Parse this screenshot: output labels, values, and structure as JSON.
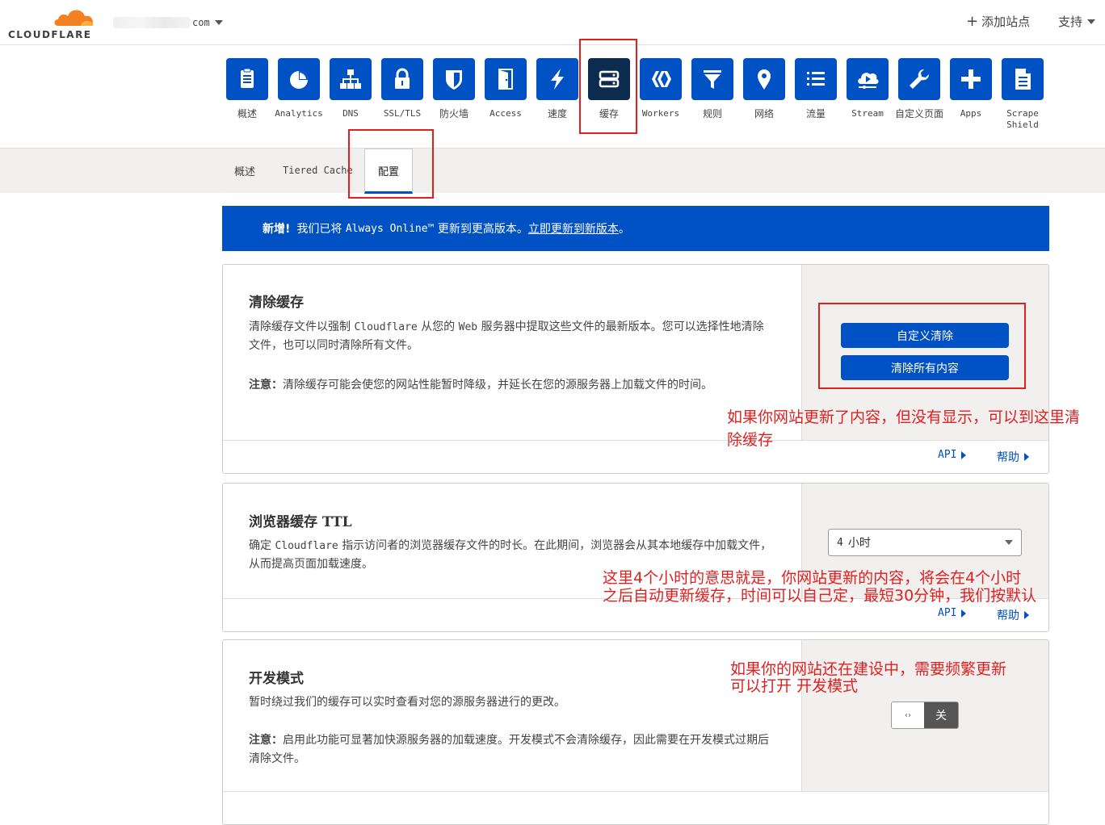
{
  "header": {
    "logo_text": "CLOUDFLARE",
    "domain_suffix": "com",
    "add_site_label": "添加站点",
    "support_label": "支持"
  },
  "apps": [
    {
      "label": "概述",
      "icon": "clipboard-icon"
    },
    {
      "label": "Analytics",
      "icon": "pie-chart-icon"
    },
    {
      "label": "DNS",
      "icon": "network-icon"
    },
    {
      "label": "SSL/TLS",
      "icon": "lock-icon"
    },
    {
      "label": "防火墙",
      "icon": "shield-icon"
    },
    {
      "label": "Access",
      "icon": "door-icon"
    },
    {
      "label": "速度",
      "icon": "lightning-icon"
    },
    {
      "label": "缓存",
      "icon": "server-icon"
    },
    {
      "label": "Workers",
      "icon": "workers-icon"
    },
    {
      "label": "规则",
      "icon": "filter-icon"
    },
    {
      "label": "网络",
      "icon": "location-pin-icon"
    },
    {
      "label": "流量",
      "icon": "list-icon"
    },
    {
      "label": "Stream",
      "icon": "cloud-play-icon"
    },
    {
      "label": "自定义页面",
      "icon": "wrench-icon"
    },
    {
      "label": "Apps",
      "icon": "plus-icon"
    },
    {
      "label": "Scrape\nShield",
      "icon": "document-icon"
    }
  ],
  "subnav": {
    "tab_overview": "概述",
    "tab_tiered": "Tiered Cache",
    "tab_config": "配置"
  },
  "banner": {
    "bold": "新增!",
    "text1": "我们已将",
    "product": "Always Online™",
    "text2": "更新到更高版本。",
    "link": "立即更新到新版本",
    "end": "。"
  },
  "purge": {
    "title": "清除缓存",
    "desc_a": "清除缓存文件以强制",
    "desc_cf": "Cloudflare",
    "desc_b": "从您的",
    "desc_web": "Web",
    "desc_c": "服务器中提取这些文件的最新版本。您可以选择性地清除文件，也可以同时清除所有文件。",
    "note_label": "注意：",
    "note_text": "清除缓存可能会使您的网站性能暂时降级，并延长在您的源服务器上加载文件的时间。",
    "custom_button": "自定义清除",
    "all_button": "清除所有内容",
    "api_link": "API",
    "help_link": "帮助"
  },
  "browser_ttl": {
    "title_a": "浏览器缓存",
    "title_b": "TTL",
    "desc_a": "确定",
    "desc_cf": "Cloudflare",
    "desc_b": "指示访问者的浏览器缓存文件的时长。在此期间，浏览器会从其本地缓存中加载文件，从而提高页面加载速度。",
    "select_num": "4",
    "select_unit": "小时",
    "api_link": "API",
    "help_link": "帮助"
  },
  "dev_mode": {
    "title": "开发模式",
    "desc": "暂时绕过我们的缓存可以实时查看对您的源服务器进行的更改。",
    "note_label": "注意：",
    "note_text": "启用此功能可显著加快源服务器的加载速度。开发模式不会清除缓存，因此需要在开发模式过期后清除文件。",
    "toggle_knob": "‹›",
    "toggle_state": "关"
  },
  "annotations": {
    "purge_note": "如果你网站更新了内容，但没有显示，可以到这里清除缓存",
    "ttl_note_1": "这里4个小时的意思就是，你网站更新的内容，将会在4个小时",
    "ttl_note_2": "之后自动更新缓存，时间可以自己定，最短30分钟，我们按默认",
    "dev_note_1": "如果你的网站还在建设中，需要频繁更新",
    "dev_note_2": "可以打开 开发模式"
  },
  "colors": {
    "accent_blue": "#0051c3",
    "active_tile": "#0c2c4f",
    "annotation_red": "#e02020",
    "logo_orange": "#f48120"
  }
}
